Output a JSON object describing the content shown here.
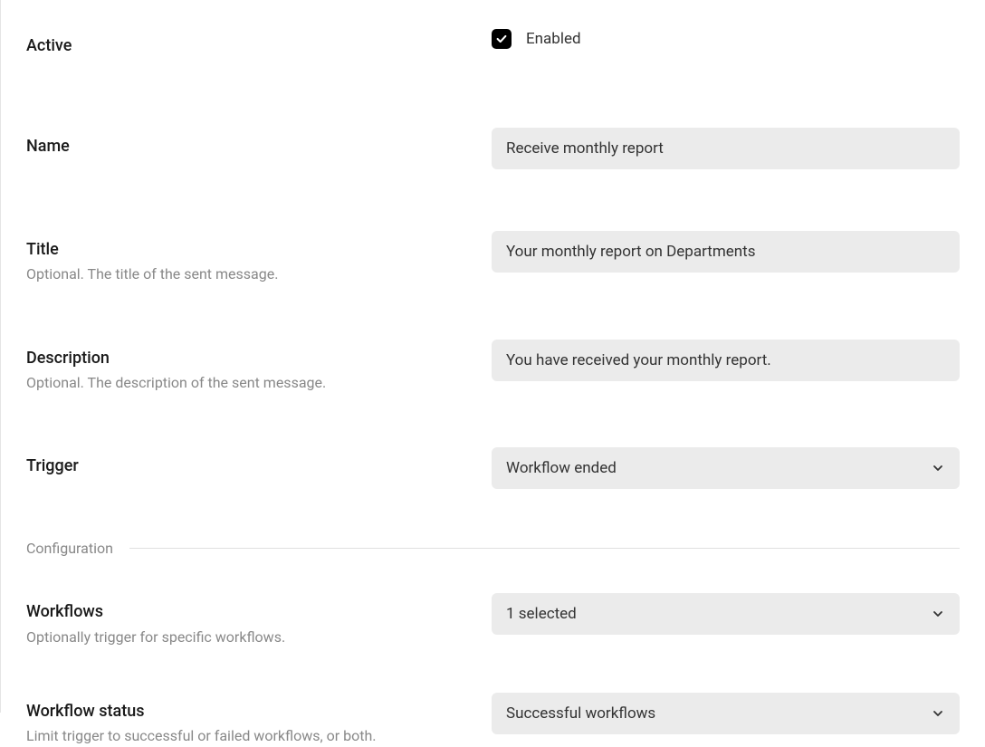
{
  "fields": {
    "active": {
      "label": "Active",
      "checkbox_label": "Enabled",
      "checked": true
    },
    "name": {
      "label": "Name",
      "value": "Receive monthly report"
    },
    "title": {
      "label": "Title",
      "hint": "Optional. The title of the sent message.",
      "value": "Your monthly report on Departments"
    },
    "description": {
      "label": "Description",
      "hint": "Optional. The description of the sent message.",
      "value": "You have received your monthly report."
    },
    "trigger": {
      "label": "Trigger",
      "value": "Workflow ended"
    }
  },
  "section": {
    "title": "Configuration"
  },
  "config": {
    "workflows": {
      "label": "Workflows",
      "hint": "Optionally trigger for specific workflows.",
      "value": "1 selected"
    },
    "workflow_status": {
      "label": "Workflow status",
      "hint": "Limit trigger to successful or failed workflows, or both.",
      "value": "Successful workflows"
    }
  }
}
